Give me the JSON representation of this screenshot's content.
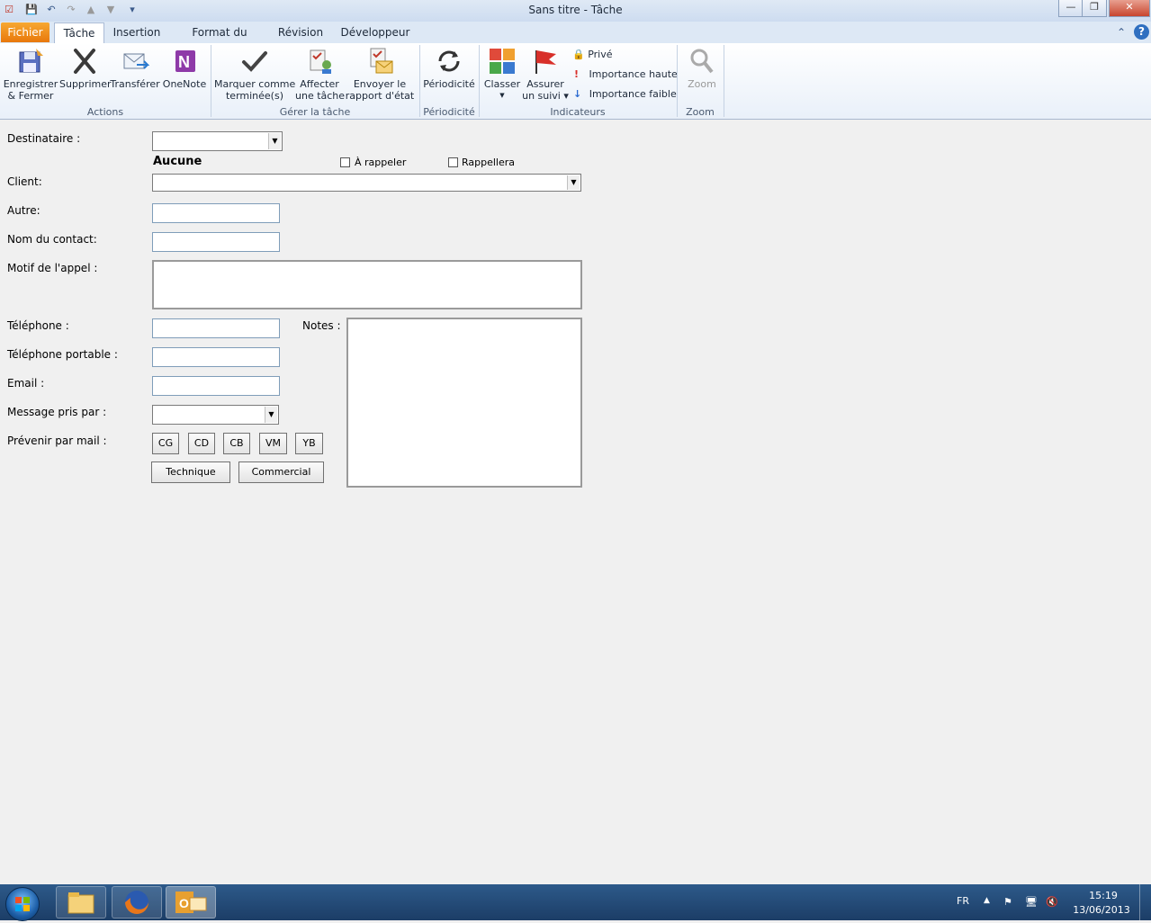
{
  "window": {
    "title": "Sans titre  -  Tâche"
  },
  "tabs": [
    "Fichier",
    "Tâche",
    "Insertion",
    "Format du texte",
    "Révision",
    "Développeur"
  ],
  "ribbon": {
    "actions": {
      "save_close": "Enregistrer\n& Fermer",
      "delete": "Supprimer",
      "forward": "Transférer",
      "onenote": "OneNote",
      "group": "Actions"
    },
    "manage": {
      "mark_complete": "Marquer comme\nterminée(s)",
      "assign": "Affecter\nune tâche",
      "send_status": "Envoyer le\nrapport d'état",
      "group": "Gérer la tâche"
    },
    "recurrence": {
      "label": "Périodicité",
      "group": "Périodicité"
    },
    "tags": {
      "categorize": "Classer",
      "follow_up": "Assurer\nun suivi",
      "private": "Privé",
      "high": "Importance haute",
      "low": "Importance faible",
      "group": "Indicateurs"
    },
    "zoom": {
      "label": "Zoom",
      "group": "Zoom"
    }
  },
  "form": {
    "destinataire_label": "Destinataire :",
    "destinataire_value": "",
    "aucune": "Aucune",
    "a_rappeler": "À rappeler",
    "rappellera": "Rappellera",
    "client_label": "Client:",
    "autre_label": "Autre:",
    "contact_label": "Nom du contact:",
    "motif_label": "Motif de l'appel :",
    "telephone_label": "Téléphone :",
    "notes_label": "Notes :",
    "portable_label": "Téléphone portable :",
    "email_label": "Email :",
    "message_label": "Message pris par :",
    "prevenir_label": "Prévenir par mail :",
    "mail_buttons": [
      "CG",
      "CD",
      "CB",
      "VM",
      "YB"
    ],
    "technique": "Technique",
    "commercial": "Commercial"
  },
  "taskbar": {
    "lang": "FR",
    "time": "15:19",
    "date": "13/06/2013"
  }
}
